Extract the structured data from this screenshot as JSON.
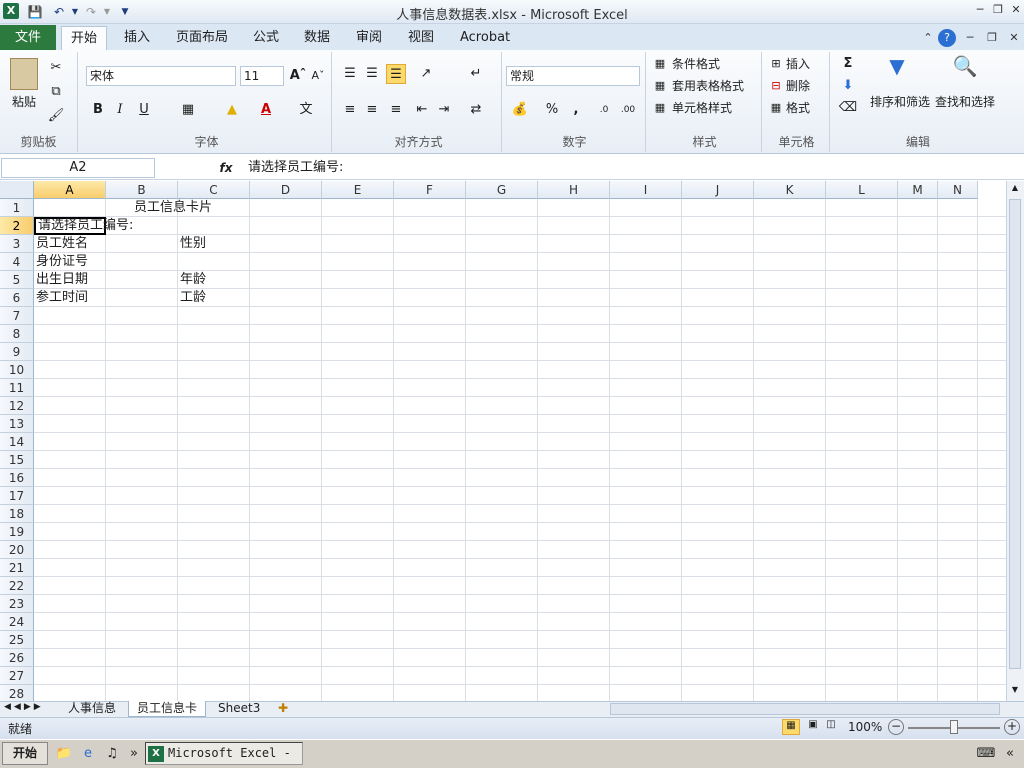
{
  "window": {
    "title": "人事信息数据表.xlsx  -  Microsoft Excel",
    "app_icon": "X"
  },
  "ribbon_tabs": [
    "文件",
    "开始",
    "插入",
    "页面布局",
    "公式",
    "数据",
    "审阅",
    "视图",
    "Acrobat"
  ],
  "active_tab": "开始",
  "clipboard": {
    "paste": "粘贴",
    "label": "剪贴板"
  },
  "font": {
    "name": "宋体",
    "size": "11",
    "label": "字体"
  },
  "alignment": {
    "label": "对齐方式"
  },
  "number": {
    "format": "常规",
    "label": "数字"
  },
  "styles": {
    "cond": "条件格式",
    "table": "套用表格格式",
    "cell": "单元格样式",
    "label": "样式"
  },
  "cells": {
    "insert": "插入",
    "delete": "删除",
    "format": "格式",
    "label": "单元格"
  },
  "editing": {
    "sort": "排序和筛选",
    "find": "查找和选择",
    "label": "编辑"
  },
  "formula_bar": {
    "name_box": "A2",
    "fx": "fx",
    "content": "请选择员工编号:"
  },
  "columns": [
    "A",
    "B",
    "C",
    "D",
    "E",
    "F",
    "G",
    "H",
    "I",
    "J",
    "K",
    "L",
    "M",
    "N"
  ],
  "rows": [
    "1",
    "2",
    "3",
    "4",
    "5",
    "6",
    "7",
    "8",
    "9",
    "10",
    "11",
    "12",
    "13",
    "14",
    "15",
    "16",
    "17",
    "18",
    "19",
    "20",
    "21",
    "22",
    "23",
    "24",
    "25",
    "26",
    "27",
    "28"
  ],
  "grid": {
    "c1": "员工信息卡片",
    "c2": "请选择员工编号:",
    "a3": "员工姓名",
    "c3": "性别",
    "a4": "身份证号",
    "a5": "出生日期",
    "c5": "年龄",
    "a6": "参工时间",
    "c6": "工龄"
  },
  "sheet_tabs": [
    "人事信息",
    "员工信息卡",
    "Sheet3"
  ],
  "active_sheet": "员工信息卡",
  "status": {
    "ready": "就绪",
    "zoom": "100%"
  },
  "taskbar": {
    "start": "开始",
    "app": "Microsoft Excel - ..."
  }
}
